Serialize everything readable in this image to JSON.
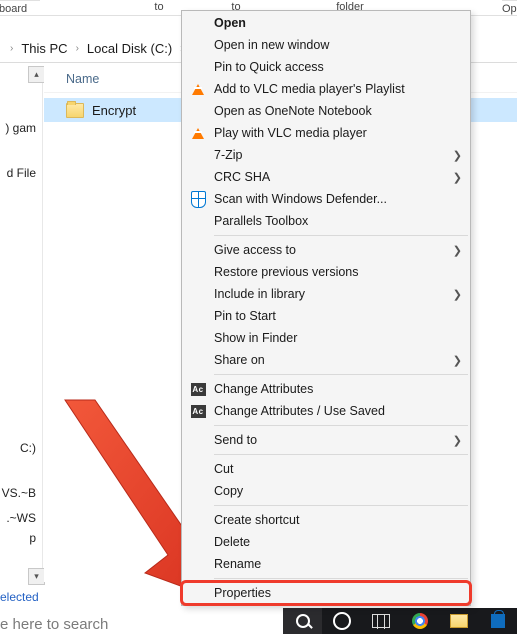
{
  "ribbon": {
    "group1": "pboard",
    "group2": "to",
    "group3": "to",
    "group4": "folder",
    "group5": "Op"
  },
  "breadcrumb": {
    "item1": "This PC",
    "item2": "Local Disk (C:)"
  },
  "sidebar": {
    "frag_game": ") gam",
    "frag_files": "d File",
    "frag_c": "C:)",
    "frag_ws1": "VS.~B",
    "frag_ws2": ".~WS",
    "frag_p": "p"
  },
  "content": {
    "col_name": "Name",
    "folder": "Encrypt"
  },
  "status": {
    "selected": "elected"
  },
  "search_hint": "e here to search",
  "context_menu": {
    "open": "Open",
    "open_new": "Open in new window",
    "pin_quick": "Pin to Quick access",
    "vlc_playlist": "Add to VLC media player's Playlist",
    "onenote": "Open as OneNote Notebook",
    "vlc_play": "Play with VLC media player",
    "sevenzip": "7-Zip",
    "crcsha": "CRC SHA",
    "defender": "Scan with Windows Defender...",
    "parallels": "Parallels Toolbox",
    "give_access": "Give access to",
    "restore_prev": "Restore previous versions",
    "include_lib": "Include in library",
    "pin_start": "Pin to Start",
    "show_finder": "Show in Finder",
    "share_on": "Share on",
    "change_attr": "Change Attributes",
    "change_attr_saved": "Change Attributes / Use Saved",
    "send_to": "Send to",
    "cut": "Cut",
    "copy": "Copy",
    "shortcut": "Create shortcut",
    "delete": "Delete",
    "rename": "Rename",
    "properties": "Properties"
  },
  "icons": {
    "ac_label": "Ac"
  }
}
